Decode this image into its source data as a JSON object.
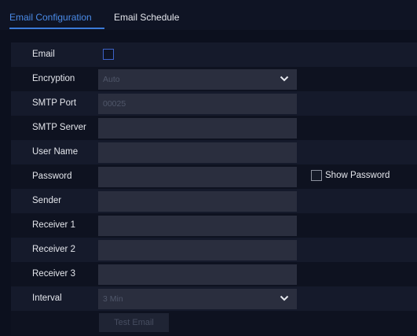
{
  "tabs": [
    {
      "label": "Email Configuration",
      "active": true
    },
    {
      "label": "Email Schedule",
      "active": false
    }
  ],
  "form": {
    "email": {
      "label": "Email",
      "checked": false
    },
    "encryption": {
      "label": "Encryption",
      "value": "Auto"
    },
    "smtp_port": {
      "label": "SMTP Port",
      "value": "00025"
    },
    "smtp_server": {
      "label": "SMTP Server",
      "value": ""
    },
    "user_name": {
      "label": "User Name",
      "value": ""
    },
    "password": {
      "label": "Password",
      "value": ""
    },
    "show_password": {
      "label": "Show Password",
      "checked": false
    },
    "sender": {
      "label": "Sender",
      "value": ""
    },
    "receiver_1": {
      "label": "Receiver 1",
      "value": ""
    },
    "receiver_2": {
      "label": "Receiver 2",
      "value": ""
    },
    "receiver_3": {
      "label": "Receiver 3",
      "value": ""
    },
    "interval": {
      "label": "Interval",
      "value": "3 Min"
    },
    "test_email_label": "Test Email"
  },
  "colors": {
    "accent": "#3b7ad8",
    "background": "#0c101e"
  }
}
